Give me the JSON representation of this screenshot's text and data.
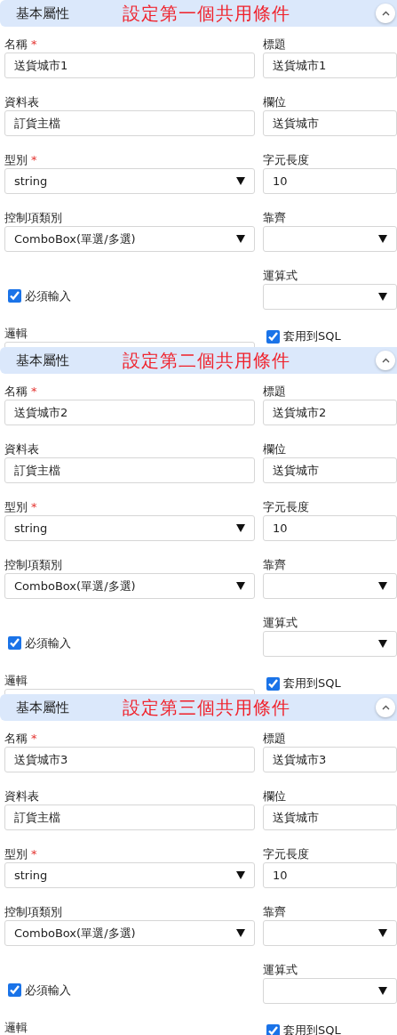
{
  "panels": [
    {
      "header": "基本屬性",
      "annotation": "設定第一個共用條件",
      "rows": [
        [
          {
            "kind": "input",
            "label": "名稱",
            "required_mark": "*",
            "value": "送貨城市1"
          },
          {
            "kind": "input",
            "label": "標題",
            "value": "送貨城市1"
          }
        ],
        [
          {
            "kind": "input",
            "label": "資料表",
            "value": "訂貨主檔"
          },
          {
            "kind": "input",
            "label": "欄位",
            "value": "送貨城市"
          }
        ],
        [
          {
            "kind": "select",
            "label": "型別",
            "required_mark": "*",
            "value": "string"
          },
          {
            "kind": "input",
            "label": "字元長度",
            "value": "10"
          }
        ],
        [
          {
            "kind": "select",
            "label": "控制項類別",
            "value": "ComboBox(單選/多選)"
          },
          {
            "kind": "select",
            "label": "靠齊"
          }
        ],
        [
          {
            "kind": "checkbox",
            "label": "必須輸入",
            "checked": true
          },
          {
            "kind": "select",
            "label": "運算式"
          }
        ],
        [
          {
            "kind": "select",
            "label": "邏輯"
          },
          {
            "kind": "checkbox",
            "label": "套用到SQL",
            "checked": true
          }
        ]
      ]
    },
    {
      "header": "基本屬性",
      "annotation": "設定第二個共用條件",
      "rows": [
        [
          {
            "kind": "input",
            "label": "名稱",
            "required_mark": "*",
            "value": "送貨城市2"
          },
          {
            "kind": "input",
            "label": "標題",
            "value": "送貨城市2"
          }
        ],
        [
          {
            "kind": "input",
            "label": "資料表",
            "value": "訂貨主檔"
          },
          {
            "kind": "input",
            "label": "欄位",
            "value": "送貨城市"
          }
        ],
        [
          {
            "kind": "select",
            "label": "型別",
            "required_mark": "*",
            "value": "string"
          },
          {
            "kind": "input",
            "label": "字元長度",
            "value": "10"
          }
        ],
        [
          {
            "kind": "select",
            "label": "控制項類別",
            "value": "ComboBox(單選/多選)"
          },
          {
            "kind": "select",
            "label": "靠齊"
          }
        ],
        [
          {
            "kind": "checkbox",
            "label": "必須輸入",
            "checked": true
          },
          {
            "kind": "select",
            "label": "運算式"
          }
        ],
        [
          {
            "kind": "select",
            "label": "邏輯"
          },
          {
            "kind": "checkbox",
            "label": "套用到SQL",
            "checked": true
          }
        ]
      ]
    },
    {
      "header": "基本屬性",
      "annotation": "設定第三個共用條件",
      "rows": [
        [
          {
            "kind": "input",
            "label": "名稱",
            "required_mark": "*",
            "value": "送貨城市3"
          },
          {
            "kind": "input",
            "label": "標題",
            "value": "送貨城市3"
          }
        ],
        [
          {
            "kind": "input",
            "label": "資料表",
            "value": "訂貨主檔"
          },
          {
            "kind": "input",
            "label": "欄位",
            "value": "送貨城市"
          }
        ],
        [
          {
            "kind": "select",
            "label": "型別",
            "required_mark": "*",
            "value": "string"
          },
          {
            "kind": "input",
            "label": "字元長度",
            "value": "10"
          }
        ],
        [
          {
            "kind": "select",
            "label": "控制項類別",
            "value": "ComboBox(單選/多選)"
          },
          {
            "kind": "select",
            "label": "靠齊"
          }
        ],
        [
          {
            "kind": "checkbox",
            "label": "必須輸入",
            "checked": true
          },
          {
            "kind": "select",
            "label": "運算式"
          }
        ],
        [
          {
            "kind": "select",
            "label": "邏輯"
          },
          {
            "kind": "checkbox",
            "label": "套用到SQL",
            "checked": true
          }
        ]
      ]
    }
  ]
}
